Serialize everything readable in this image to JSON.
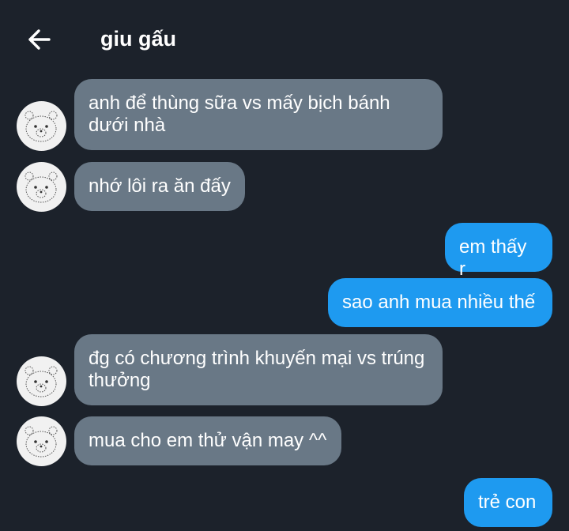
{
  "header": {
    "title": "giu gấu",
    "back_icon": "arrow-left-icon"
  },
  "avatar_icon": "bear-doodle-avatar",
  "colors": {
    "background": "#1c222b",
    "incoming_bubble": "#697886",
    "outgoing_bubble": "#1e9af0",
    "text": "#ffffff"
  },
  "messages": [
    {
      "direction": "incoming",
      "text": "anh để thùng sữa vs mấy bịch bánh dưới nhà"
    },
    {
      "direction": "incoming",
      "text": "nhớ lôi ra ăn đấy"
    },
    {
      "direction": "outgoing",
      "text": "em thấy r"
    },
    {
      "direction": "outgoing",
      "text": "sao anh mua nhiều thế"
    },
    {
      "direction": "incoming",
      "text": "đg có chương trình khuyến mại vs trúng thưởng"
    },
    {
      "direction": "incoming",
      "text": "mua cho em thử vận may ^^"
    },
    {
      "direction": "outgoing",
      "text": "trẻ con"
    }
  ]
}
